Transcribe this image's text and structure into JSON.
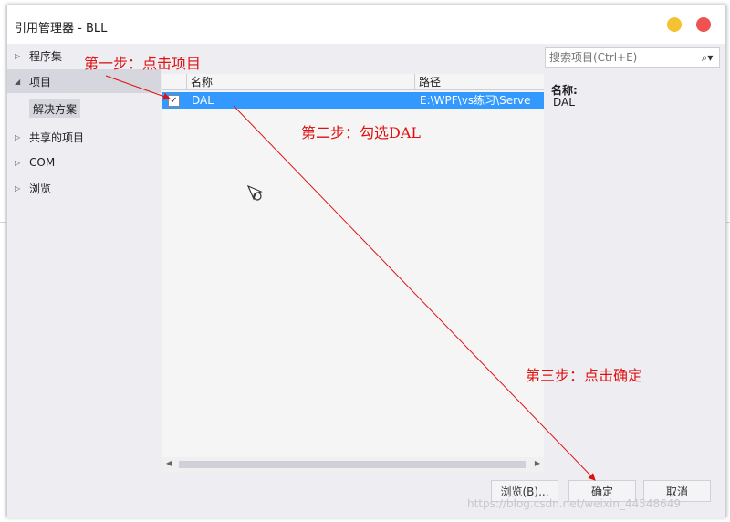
{
  "window": {
    "title": "引用管理器 - BLL"
  },
  "nav": {
    "items": [
      {
        "label": "程序集",
        "expanded": false
      },
      {
        "label": "项目",
        "expanded": true
      },
      {
        "label": "共享的项目",
        "expanded": false
      },
      {
        "label": "COM",
        "expanded": false
      },
      {
        "label": "浏览",
        "expanded": false
      }
    ],
    "sub_item": "解决方案"
  },
  "list": {
    "columns": [
      "名称",
      "路径"
    ],
    "rows": [
      {
        "checked": true,
        "name": "DAL",
        "path": "E:\\WPF\\vs练习\\Serve"
      }
    ]
  },
  "search": {
    "placeholder": "搜索项目(Ctrl+E)"
  },
  "details": {
    "name_label": "名称:",
    "name_value": "DAL"
  },
  "buttons": {
    "browse": "浏览(B)...",
    "ok": "确定",
    "cancel": "取消"
  },
  "annotations": {
    "step1": "第一步：点击项目",
    "step2": "第二步：勾选DAL",
    "step3": "第三步：点击确定"
  },
  "watermark": "https://blog.csdn.net/weixin_44548649",
  "colors": {
    "accent": "#3399ff",
    "annotation": "#e01010",
    "min": "#f5c232",
    "close": "#ee5352"
  }
}
